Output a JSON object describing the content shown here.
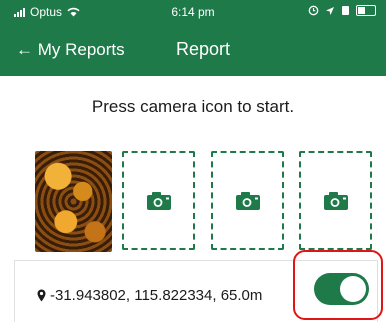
{
  "status_bar": {
    "carrier": "Optus",
    "time": "6:14 pm"
  },
  "nav": {
    "back_label": "← My Reports",
    "title": "Report"
  },
  "instruction": "Press camera icon to start.",
  "photo_slots": [
    {
      "state": "photo"
    },
    {
      "state": "empty",
      "icon": "camera-icon"
    },
    {
      "state": "empty",
      "icon": "camera-icon"
    },
    {
      "state": "empty",
      "icon": "camera-icon"
    }
  ],
  "location": {
    "icon": "map-pin-icon",
    "text": "-31.943802, 115.822334, 65.0m",
    "toggle_on": true
  },
  "colors": {
    "brand_green": "#1f7a4a",
    "highlight_red": "#e01515"
  }
}
